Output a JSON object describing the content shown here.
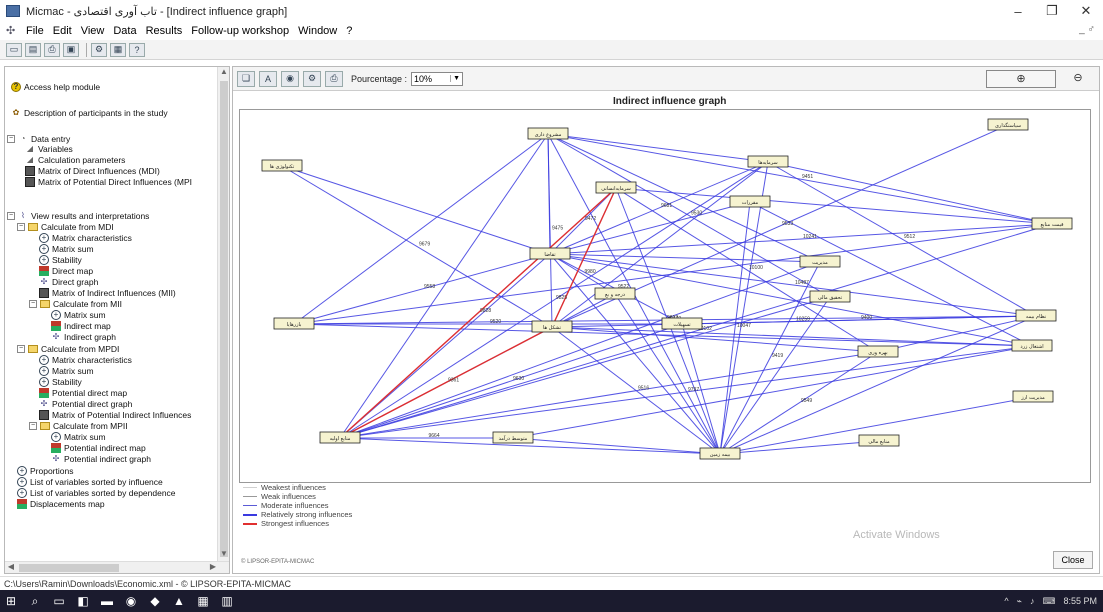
{
  "window": {
    "title": "Micmac - تاب آوری اقتصادی - [Indirect influence graph]",
    "minimize": "–",
    "restore": "❐",
    "close": "✕",
    "mdi_controls": "_ ♂"
  },
  "menu": [
    "File",
    "Edit",
    "View",
    "Data",
    "Results",
    "Follow-up workshop",
    "Window",
    "?"
  ],
  "tree": {
    "help": "Access help module",
    "participants": "Description of participants in the study",
    "data_entry": "Data entry",
    "variables": "Variables",
    "calc_params": "Calculation parameters",
    "mdi": "Matrix of Direct Influences (MDI)",
    "mpdi": "Matrix of Potential Direct Influences (MPI",
    "view_results": "View results and interpretations",
    "calc_mdi": "Calculate from MDI",
    "matrix_char": "Matrix characteristics",
    "matrix_sum": "Matrix sum",
    "stability": "Stability",
    "direct_map": "Direct map",
    "direct_graph": "Direct graph",
    "mii": "Matrix of Indirect Influences (MII)",
    "calc_mii": "Calculate from MII",
    "mii_sum": "Matrix sum",
    "indirect_map": "Indirect map",
    "indirect_graph": "Indirect graph",
    "calc_mpdi": "Calculate from MPDI",
    "mpdi_char": "Matrix characteristics",
    "mpdi_sum": "Matrix sum",
    "mpdi_stab": "Stability",
    "pot_direct_map": "Potential direct map",
    "pot_direct_graph": "Potential direct graph",
    "mpii": "Matrix of Potential Indirect Influences",
    "calc_mpii": "Calculate from MPII",
    "mpii_sum": "Matrix sum",
    "pot_indirect_map": "Potential indirect map",
    "pot_indirect_graph": "Potential indirect graph",
    "proportions": "Proportions",
    "sorted_influence": "List of variables sorted by influence",
    "sorted_dependence": "List of variables sorted by dependence",
    "displacements": "Displacements map"
  },
  "graph_toolbar": {
    "percentage_label": "Pourcentage :",
    "percentage_value": "10%"
  },
  "graph": {
    "title": "Indirect influence graph",
    "legend": [
      {
        "label": "Weakest influences",
        "color": "#d0d0d0"
      },
      {
        "label": "Weak influences",
        "color": "#999999"
      },
      {
        "label": "Moderate influences",
        "color": "#5b5bd6"
      },
      {
        "label": "Relatively strong influences",
        "color": "#3a3ae0"
      },
      {
        "label": "Strongest influences",
        "color": "#e03030"
      }
    ],
    "copyright": "© LIPSOR-EPITA-MICMAC",
    "watermark": "Activate Windows",
    "close": "Close",
    "nodes": [
      {
        "id": "n1",
        "label": "مشروع دارى"
      },
      {
        "id": "n2",
        "label": "تکنولوژی ها"
      },
      {
        "id": "n3",
        "label": "سرمایه‌ها"
      },
      {
        "id": "n4",
        "label": "سیاستگذاری"
      },
      {
        "id": "n5",
        "label": "سرمایه‌انسانی"
      },
      {
        "id": "n6",
        "label": "مقررات"
      },
      {
        "id": "n7",
        "label": "قیمت منابع"
      },
      {
        "id": "n8",
        "label": "تقاضا"
      },
      {
        "id": "n9",
        "label": "مدیریت"
      },
      {
        "id": "n10",
        "label": "درجه و بع"
      },
      {
        "id": "n11",
        "label": "نظام بیمه"
      },
      {
        "id": "n12",
        "label": "تحقیق مالی"
      },
      {
        "id": "n13",
        "label": "تسهیلات"
      },
      {
        "id": "n14",
        "label": "بازرهایا"
      },
      {
        "id": "n15",
        "label": "تشکل ها"
      },
      {
        "id": "n16",
        "label": "اشتغال زرد"
      },
      {
        "id": "n17",
        "label": "بهره وری"
      },
      {
        "id": "n18",
        "label": "مدیریت ارز"
      },
      {
        "id": "n19",
        "label": "منابع اولیه"
      },
      {
        "id": "n20",
        "label": "متوسط درآمد"
      },
      {
        "id": "n21",
        "label": "بیمه زمین"
      },
      {
        "id": "n22",
        "label": "منابع مالی"
      }
    ],
    "edge_labels": [
      "9828",
      "9361",
      "9825",
      "10102",
      "9797",
      "9630",
      "9664",
      "9558",
      "9612",
      "9520",
      "9679",
      "9475",
      "9451",
      "9530",
      "9681",
      "10241",
      "10487",
      "9522",
      "9472",
      "9470",
      "10100",
      "10259",
      "9516",
      "9533",
      "9980",
      "9400",
      "9512",
      "10047",
      "9419",
      "9549"
    ]
  },
  "statusbar": "C:\\Users\\Ramin\\Downloads\\Economic.xml - © LIPSOR-EPITA-MICMAC",
  "tray": {
    "caret": "^",
    "time": "8:55 PM"
  }
}
